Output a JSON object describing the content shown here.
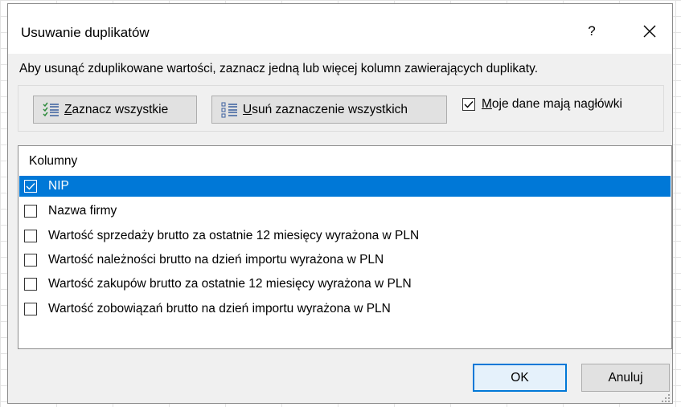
{
  "dialog": {
    "title": "Usuwanie duplikatów",
    "help_label": "?",
    "close_icon": "close-icon",
    "instruction": "Aby usunąć zduplikowane wartości, zaznacz jedną lub więcej kolumn zawierających duplikaty."
  },
  "toolbar": {
    "select_all_key": "Z",
    "select_all_rest": "aznacz wszystkie",
    "select_all_icon": "select-all-list-icon",
    "unselect_all_key": "U",
    "unselect_all_rest": "suń zaznaczenie wszystkich",
    "unselect_all_icon": "unselect-all-list-icon",
    "headers_key": "M",
    "headers_rest": "oje dane mają nagłówki",
    "headers_checked": true
  },
  "columns": {
    "header": "Kolumny",
    "items": [
      {
        "label": "NIP",
        "checked": true,
        "selected": true
      },
      {
        "label": "Nazwa firmy",
        "checked": false,
        "selected": false
      },
      {
        "label": "Wartość sprzedaży brutto za ostatnie 12 miesięcy wyrażona w PLN",
        "checked": false,
        "selected": false
      },
      {
        "label": "Wartość należności brutto na dzień importu wyrażona w PLN",
        "checked": false,
        "selected": false
      },
      {
        "label": "Wartość zakupów brutto za ostatnie 12 miesięcy wyrażona w PLN",
        "checked": false,
        "selected": false
      },
      {
        "label": "Wartość zobowiązań brutto na dzień importu wyrażona w PLN",
        "checked": false,
        "selected": false
      }
    ]
  },
  "footer": {
    "ok_label": "OK",
    "cancel_label": "Anuluj"
  },
  "colors": {
    "accent": "#0078d7",
    "dialog_bg": "#f0f0f0",
    "button_bg": "#e1e1e1"
  }
}
